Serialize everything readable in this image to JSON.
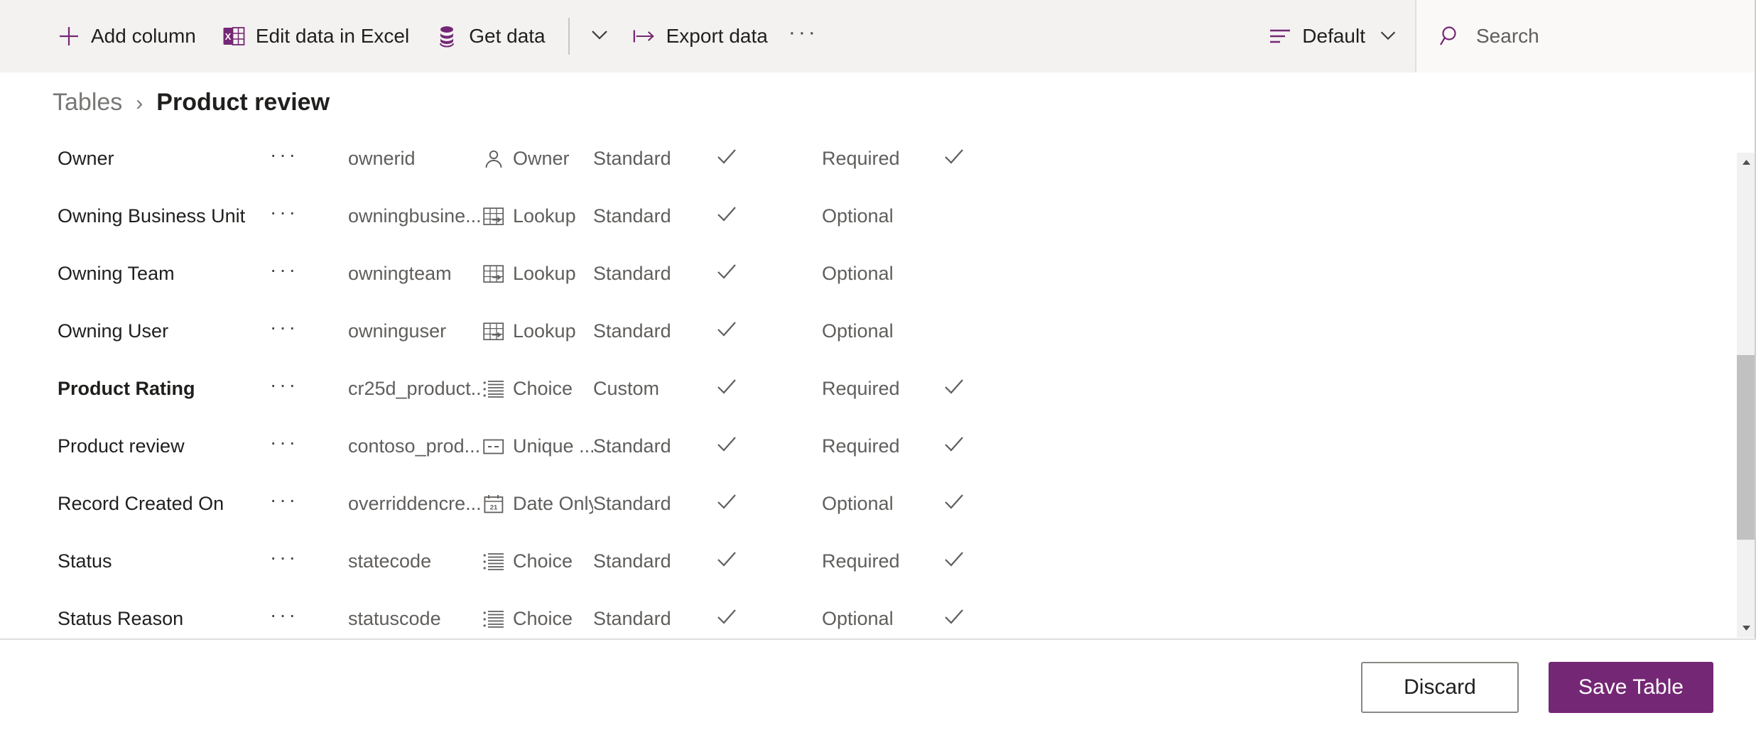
{
  "toolbar": {
    "buttons": [
      {
        "label": "Add column",
        "icon": "plus-icon"
      },
      {
        "label": "Edit data in Excel",
        "icon": "excel-icon"
      },
      {
        "label": "Get data",
        "icon": "database-icon"
      }
    ],
    "chevron_icon": "chevron-down-icon",
    "export": {
      "label": "Export data",
      "icon": "export-icon"
    },
    "overflow_label": "···",
    "view": {
      "label": "Default",
      "icon": "view-list-icon",
      "chevron_icon": "chevron-down-icon"
    },
    "search": {
      "placeholder": "Search",
      "icon": "search-icon"
    }
  },
  "breadcrumb": {
    "root": "Tables",
    "separator": "›",
    "current": "Product review"
  },
  "grid": {
    "row_menu": "···",
    "check_mark": "✓",
    "rows": [
      {
        "display_name": "Owner",
        "bold": false,
        "logical_name": "ownerid",
        "data_type": "Owner",
        "type_icon": "person-icon",
        "customization": "Standard",
        "searchable": true,
        "requirement": "Required",
        "required_check": true
      },
      {
        "display_name": "Owning Business Unit",
        "bold": false,
        "logical_name": "owningbusine...",
        "data_type": "Lookup",
        "type_icon": "lookup-icon",
        "customization": "Standard",
        "searchable": true,
        "requirement": "Optional",
        "required_check": false
      },
      {
        "display_name": "Owning Team",
        "bold": false,
        "logical_name": "owningteam",
        "data_type": "Lookup",
        "type_icon": "lookup-icon",
        "customization": "Standard",
        "searchable": true,
        "requirement": "Optional",
        "required_check": false
      },
      {
        "display_name": "Owning User",
        "bold": false,
        "logical_name": "owninguser",
        "data_type": "Lookup",
        "type_icon": "lookup-icon",
        "customization": "Standard",
        "searchable": true,
        "requirement": "Optional",
        "required_check": false
      },
      {
        "display_name": "Product Rating",
        "bold": true,
        "logical_name": "cr25d_product...",
        "data_type": "Choice",
        "type_icon": "choice-icon",
        "customization": "Custom",
        "searchable": true,
        "requirement": "Required",
        "required_check": true
      },
      {
        "display_name": "Product review",
        "bold": false,
        "logical_name": "contoso_prod...",
        "data_type": "Unique ...",
        "type_icon": "unique-identifier-icon",
        "customization": "Standard",
        "searchable": true,
        "requirement": "Required",
        "required_check": true
      },
      {
        "display_name": "Record Created On",
        "bold": false,
        "logical_name": "overriddencre...",
        "data_type": "Date Only",
        "type_icon": "calendar-icon",
        "customization": "Standard",
        "searchable": true,
        "requirement": "Optional",
        "required_check": true
      },
      {
        "display_name": "Status",
        "bold": false,
        "logical_name": "statecode",
        "data_type": "Choice",
        "type_icon": "choice-icon",
        "customization": "Standard",
        "searchable": true,
        "requirement": "Required",
        "required_check": true
      },
      {
        "display_name": "Status Reason",
        "bold": false,
        "logical_name": "statuscode",
        "data_type": "Choice",
        "type_icon": "choice-icon",
        "customization": "Standard",
        "searchable": true,
        "requirement": "Optional",
        "required_check": true
      }
    ]
  },
  "footer": {
    "discard_label": "Discard",
    "save_label": "Save Table"
  },
  "colors": {
    "accent": "#742774",
    "toolbar_bg": "#f3f2f1",
    "text": "#201f1e",
    "muted_text": "#605e5c"
  }
}
